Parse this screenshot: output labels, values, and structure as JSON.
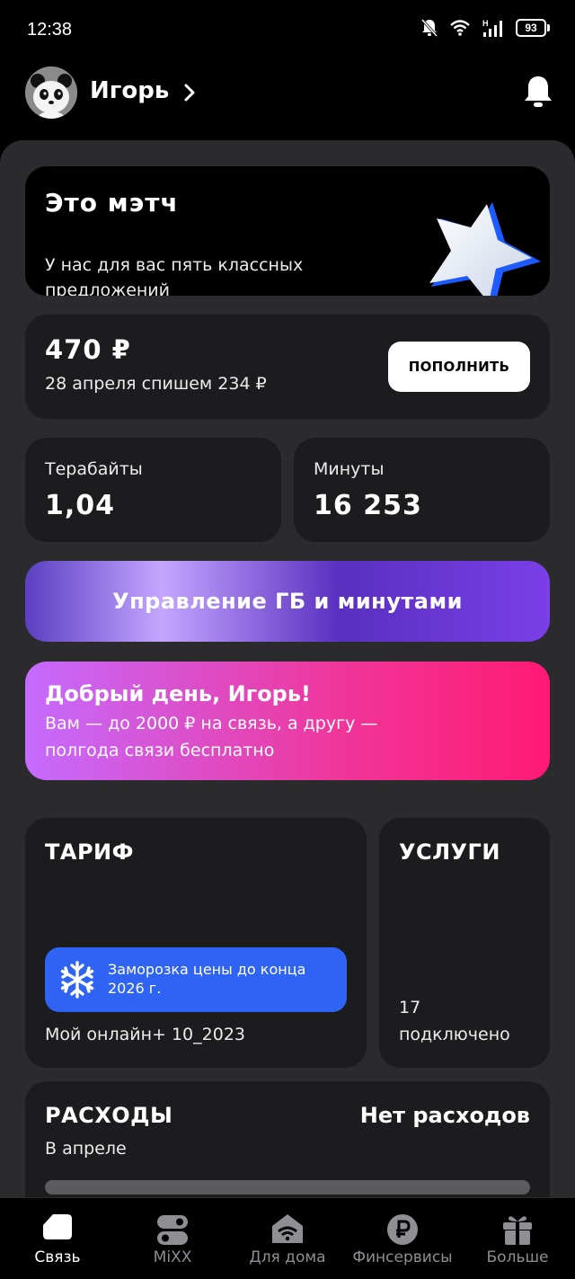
{
  "status_bar": {
    "time": "12:38",
    "battery": "93"
  },
  "header": {
    "user_name": "Игорь"
  },
  "match_card": {
    "title": "Это мэтч",
    "subtitle": "У нас для вас пять классных предложений"
  },
  "balance": {
    "amount": "470 ₽",
    "next_charge": "28 апреля спишем 234 ₽",
    "topup_label": "ПОПОЛНИТЬ"
  },
  "stats": {
    "terabytes": {
      "label": "Терабайты",
      "value": "1,04"
    },
    "minutes": {
      "label": "Минуты",
      "value": "16 253"
    }
  },
  "manage_button": {
    "label": "Управление ГБ и минутами"
  },
  "promo": {
    "title": "Добрый день, Игорь!",
    "text": "Вам — до 2000 ₽ на связь, а другу — полгода связи бесплатно"
  },
  "tariff": {
    "title": "ТАРИФ",
    "freeze_text": "Заморозка цены до конца 2026 г.",
    "plan_name": "Мой онлайн+ 10_2023"
  },
  "services": {
    "title": "УСЛУГИ",
    "count": "17",
    "connected_label": "подключено"
  },
  "expenses": {
    "title": "РАСХОДЫ",
    "status": "Нет расходов",
    "period": "В апреле"
  },
  "bottom_nav": {
    "items": [
      {
        "label": "Связь",
        "icon": "sim-icon",
        "active": true
      },
      {
        "label": "MiXX",
        "icon": "mixx-icon",
        "active": false
      },
      {
        "label": "Для дома",
        "icon": "home-wifi-icon",
        "active": false
      },
      {
        "label": "Финсервисы",
        "icon": "ruble-icon",
        "active": false
      },
      {
        "label": "Больше",
        "icon": "gift-icon",
        "active": false
      }
    ]
  },
  "colors": {
    "accent_purple": "#5a2fc0",
    "promo_pink": "#ff1a74",
    "freeze_blue": "#2f63f3",
    "panel_bg": "#2b2b2d",
    "card_bg": "#1c1c1e"
  }
}
